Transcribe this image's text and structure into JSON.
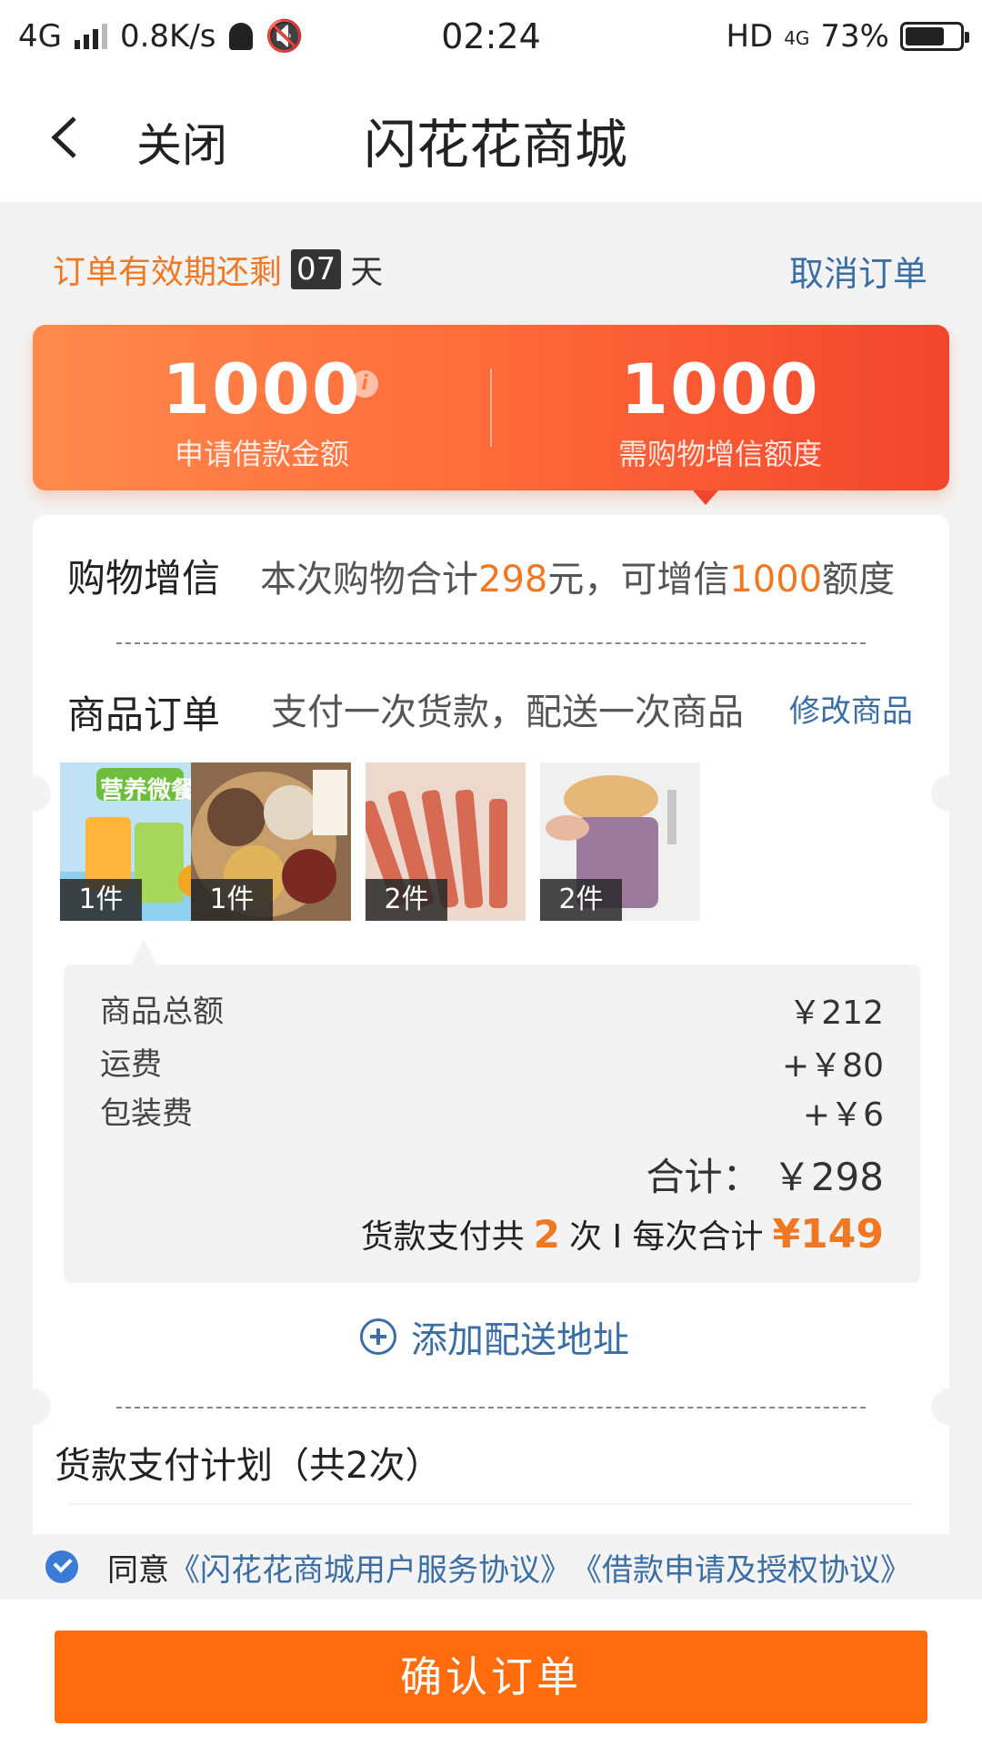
{
  "status_bar": {
    "network": "4G",
    "speed": "0.8K/s",
    "time": "02:24",
    "hd": "HD",
    "hd_network": "4G",
    "battery": "73%",
    "battery_level": 0.73
  },
  "nav": {
    "close_label": "关闭",
    "title": "闪花花商城"
  },
  "validity": {
    "prefix": "订单有效期还剩",
    "days": "07",
    "unit": "天",
    "cancel_label": "取消订单"
  },
  "loan": {
    "apply_amount": "1000",
    "apply_label": "申请借款金额",
    "info_icon": "i",
    "credit_amount": "1000",
    "credit_label": "需购物增信额度"
  },
  "shopping_credit": {
    "title": "购物增信",
    "desc_prefix": "本次购物合计",
    "amount": "298",
    "desc_mid": "元，可增信",
    "credit": "1000",
    "desc_suffix": "额度"
  },
  "order": {
    "title": "商品订单",
    "desc": "支付一次货款，配送一次商品",
    "modify_label": "修改商品",
    "items": [
      {
        "image": "nutrition-meal-image",
        "banner": "营养微餐",
        "quantity": "1件"
      },
      {
        "image": "grains-image",
        "quantity": "1件"
      },
      {
        "image": "snack-sticks-image",
        "quantity": "2件"
      },
      {
        "image": "cleaning-cloth-image",
        "quantity": "2件"
      }
    ]
  },
  "fees": {
    "goods_label": "商品总额",
    "goods_value": "￥212",
    "shipping_label": "运费",
    "shipping_value": "+￥80",
    "packing_label": "包装费",
    "packing_value": "+￥6",
    "total_label": "合计：",
    "total_value": "￥298",
    "pay_prefix": "货款支付共",
    "pay_times": "2",
    "pay_mid": "次 I 每次合计",
    "pay_each": "¥149"
  },
  "address": {
    "add_label": "添加配送地址"
  },
  "plan": {
    "title": "货款支付计划（共2次）"
  },
  "agreement": {
    "agree": "同意",
    "link1": "《闪花花商城用户服务协议》",
    "link2": "《借款申请及授权协议》"
  },
  "confirm_label": "确认订单",
  "colors": {
    "accent": "#f07822",
    "link": "#3a6ea5",
    "button": "#ff6c0e",
    "card_start": "#ff8a4c",
    "card_end": "#f2452d"
  }
}
